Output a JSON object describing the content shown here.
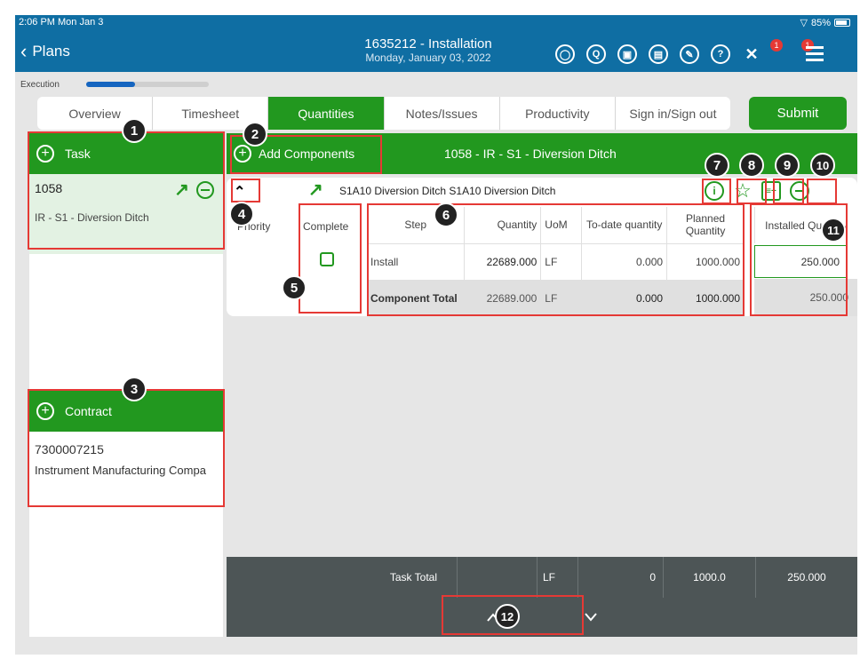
{
  "status": {
    "time": "2:06 PM   Mon Jan 3",
    "battery": "85%"
  },
  "header": {
    "back_label": "Plans",
    "title": "1635212 - Installation",
    "subtitle": "Monday, January 03, 2022",
    "notification_count": "1",
    "menu_count": "1"
  },
  "execution": {
    "label": "Execution",
    "progress_fraction": 0.4
  },
  "tabs": [
    {
      "label": "Overview"
    },
    {
      "label": "Timesheet"
    },
    {
      "label": "Quantities"
    },
    {
      "label": "Notes/Issues"
    },
    {
      "label": "Productivity"
    },
    {
      "label": "Sign in/Sign out"
    }
  ],
  "submit_label": "Submit",
  "task_section": {
    "header": "Task",
    "id": "1058",
    "description": "IR - S1 - Diversion Ditch"
  },
  "contract_section": {
    "header": "Contract",
    "id": "7300007215",
    "name": "Instrument Manufacturing Compa"
  },
  "component": {
    "add_label": "Add Components",
    "header_title": "1058 - IR - S1 - Diversion Ditch",
    "name": "S1A10 Diversion Ditch S1A10 Diversion Ditch",
    "priority_label": "Priority",
    "complete_label": "Complete",
    "columns": [
      "Step",
      "Quantity",
      "UoM",
      "To-date quantity",
      "Planned Quantity"
    ],
    "installed_label": "Installed Quantity",
    "rows": [
      {
        "step": "Install",
        "quantity": "22689.000",
        "uom": "LF",
        "todate": "0.000",
        "planned": "1000.000",
        "installed": "250.000"
      }
    ],
    "total": {
      "step": "Component Total",
      "quantity": "22689.000",
      "uom": "LF",
      "todate": "0.000",
      "planned": "1000.000",
      "installed": "250.000"
    }
  },
  "task_total": {
    "label": "Task Total",
    "uom": "LF",
    "todate": "0",
    "planned": "1000.0",
    "installed": "250.000"
  },
  "annotations": [
    "1",
    "2",
    "3",
    "4",
    "5",
    "6",
    "7",
    "8",
    "9",
    "10",
    "11",
    "12"
  ]
}
